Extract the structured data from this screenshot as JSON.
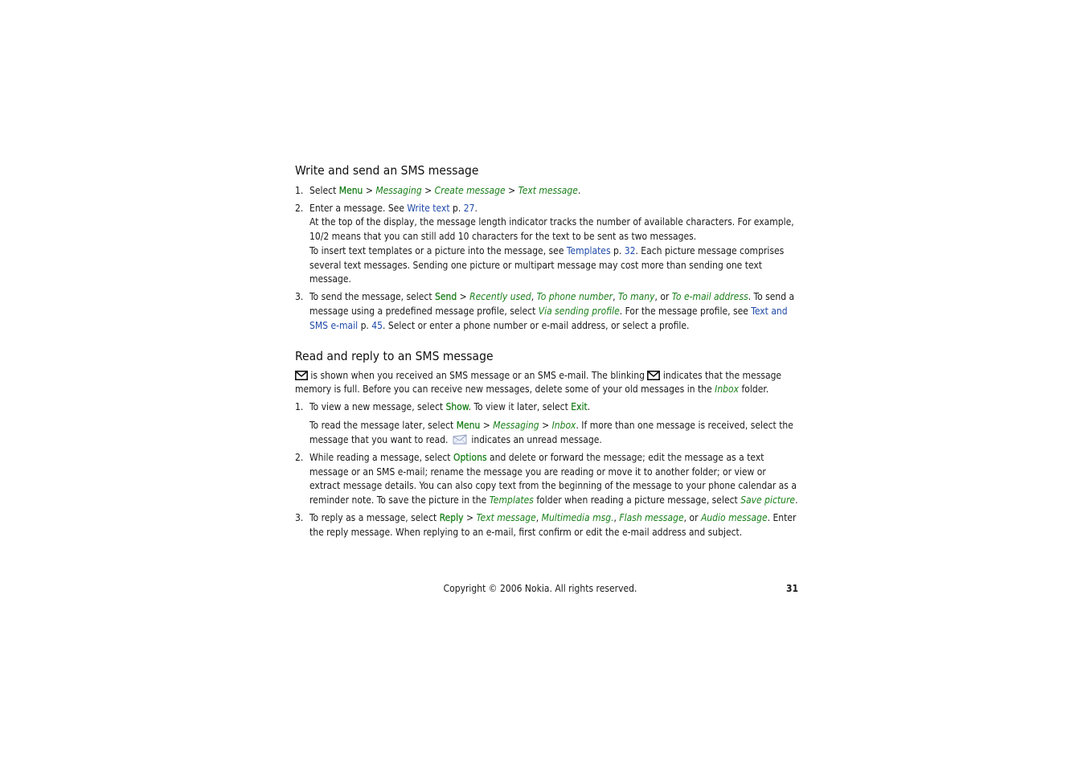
{
  "section1": {
    "title": "Write and send an SMS message",
    "steps": [
      {
        "num": "1.",
        "paragraphs": [
          [
            {
              "t": "Select "
            },
            {
              "t": "Menu",
              "s": "menu"
            },
            {
              "t": " > "
            },
            {
              "t": "Messaging",
              "s": "opt"
            },
            {
              "t": " > "
            },
            {
              "t": "Create message",
              "s": "opt"
            },
            {
              "t": " > "
            },
            {
              "t": "Text message",
              "s": "opt"
            },
            {
              "t": "."
            }
          ]
        ]
      },
      {
        "num": "2.",
        "paragraphs": [
          [
            {
              "t": "Enter a message. See "
            },
            {
              "t": "Write text",
              "s": "link"
            },
            {
              "t": " p. "
            },
            {
              "t": "27",
              "s": "link"
            },
            {
              "t": "."
            }
          ],
          [
            {
              "t": "At the top of the display, the message length indicator tracks the number of available characters. For example, 10/2 means that you can still add 10 characters for the text to be sent as two messages."
            }
          ],
          [
            {
              "t": "To insert text templates or a picture into the message, see "
            },
            {
              "t": "Templates",
              "s": "link"
            },
            {
              "t": " p. "
            },
            {
              "t": "32",
              "s": "link"
            },
            {
              "t": ". Each picture message comprises several text messages. Sending one picture or multipart message may cost more than sending one text message."
            }
          ]
        ]
      },
      {
        "num": "3.",
        "paragraphs": [
          [
            {
              "t": "To send the message, select "
            },
            {
              "t": "Send",
              "s": "menu"
            },
            {
              "t": " > "
            },
            {
              "t": "Recently used",
              "s": "opt"
            },
            {
              "t": ", "
            },
            {
              "t": "To phone number",
              "s": "opt"
            },
            {
              "t": ", "
            },
            {
              "t": "To many",
              "s": "opt"
            },
            {
              "t": ", or "
            },
            {
              "t": "To e-mail address",
              "s": "opt"
            },
            {
              "t": ". To send a message using a predefined message profile, select "
            },
            {
              "t": "Via sending profile",
              "s": "opt"
            },
            {
              "t": ". For the message profile, see "
            },
            {
              "t": "Text and SMS e-mail",
              "s": "link"
            },
            {
              "t": " p. "
            },
            {
              "t": "45",
              "s": "link"
            },
            {
              "t": ". Select or enter a phone number or e-mail address, or select a profile."
            }
          ]
        ]
      }
    ]
  },
  "section2": {
    "title": "Read and reply to an SMS message",
    "intro": [
      {
        "icon": "envelope-icon"
      },
      {
        "t": " is shown when you received an SMS message or an SMS e-mail. The blinking "
      },
      {
        "icon": "envelope-icon"
      },
      {
        "t": " indicates that the message memory is full. Before you can receive new messages, delete some of your old messages in the "
      },
      {
        "t": "Inbox",
        "s": "opt"
      },
      {
        "t": " folder."
      }
    ],
    "steps": [
      {
        "num": "1.",
        "paragraphs": [
          [
            {
              "t": "To view a new message, select "
            },
            {
              "t": "Show",
              "s": "menu"
            },
            {
              "t": ". To view it later, select "
            },
            {
              "t": "Exit",
              "s": "menu"
            },
            {
              "t": "."
            }
          ],
          [
            {
              "t": "To read the message later, select "
            },
            {
              "t": "Menu",
              "s": "menu"
            },
            {
              "t": " > "
            },
            {
              "t": "Messaging",
              "s": "opt"
            },
            {
              "t": " > "
            },
            {
              "t": "Inbox",
              "s": "opt"
            },
            {
              "t": ". If more than one message is received, select the message that you want to read. "
            },
            {
              "icon": "unread-message-icon"
            },
            {
              "t": " indicates an unread message."
            }
          ]
        ]
      },
      {
        "num": "2.",
        "paragraphs": [
          [
            {
              "t": "While reading a message, select "
            },
            {
              "t": "Options",
              "s": "menu"
            },
            {
              "t": " and delete or forward the message; edit the message as a text message or an SMS e-mail; rename the message you are reading or move it to another folder; or view or extract message details. You can also copy text from the beginning of the message to your phone calendar as a reminder note. To save the picture in the "
            },
            {
              "t": "Templates",
              "s": "opt"
            },
            {
              "t": " folder when reading a picture message, select "
            },
            {
              "t": "Save picture",
              "s": "opt"
            },
            {
              "t": "."
            }
          ]
        ]
      },
      {
        "num": "3.",
        "paragraphs": [
          [
            {
              "t": "To reply as a message, select "
            },
            {
              "t": "Reply",
              "s": "menu"
            },
            {
              "t": " > "
            },
            {
              "t": "Text message",
              "s": "opt"
            },
            {
              "t": ", "
            },
            {
              "t": "Multimedia msg.",
              "s": "opt"
            },
            {
              "t": ", "
            },
            {
              "t": "Flash message",
              "s": "opt"
            },
            {
              "t": ", or "
            },
            {
              "t": "Audio message",
              "s": "opt"
            },
            {
              "t": ". Enter the reply message. When replying to an e-mail, first confirm or edit the e-mail address and subject."
            }
          ]
        ]
      }
    ]
  },
  "footer": {
    "copyright": "Copyright © 2006 Nokia. All rights reserved.",
    "page_number": "31"
  },
  "colors": {
    "menu": "#1a7f1a",
    "option": "#1a7f1a",
    "link": "#1f4aa8",
    "text": "#1a1a1a"
  }
}
